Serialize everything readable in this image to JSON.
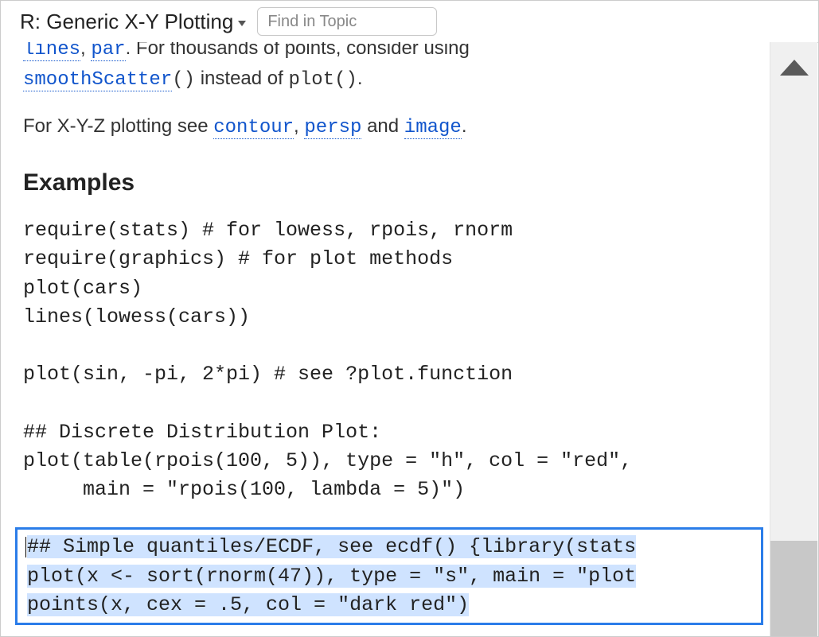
{
  "header": {
    "title": "R: Generic X-Y Plotting",
    "search_placeholder": "Find in Topic"
  },
  "cutLine": {
    "link_lines": "lines",
    "sep1": ", ",
    "link_par": "par",
    "rest": ". For thousands of points, consider using"
  },
  "line2": {
    "link_smooth": "smoothScatter",
    "after_paren": "()",
    "mid": " instead of ",
    "plot": "plot",
    "plot_paren": "()",
    "dot": "."
  },
  "xy3": {
    "before": "For X-Y-Z plotting see ",
    "link_contour": "contour",
    "c1": ", ",
    "link_persp": "persp",
    "c2": " and ",
    "link_image": "image",
    "dot": "."
  },
  "heading_examples": "Examples",
  "code_block": "require(stats) # for lowess, rpois, rnorm\nrequire(graphics) # for plot methods\nplot(cars)\nlines(lowess(cars))\n\nplot(sin, -pi, 2*pi) # see ?plot.function\n\n## Discrete Distribution Plot:\nplot(table(rpois(100, 5)), type = \"h\", col = \"red\",\n     main = \"rpois(100, lambda = 5)\")",
  "selected": {
    "l1a": "#",
    "l1b": "# Simple quantiles/ECDF, see ecdf() {library(stats",
    "l2": "plot(x <- sort(rnorm(47)), type = \"s\", main = \"plot",
    "l3": "points(x, cex = .5, col = \"dark red\")"
  }
}
